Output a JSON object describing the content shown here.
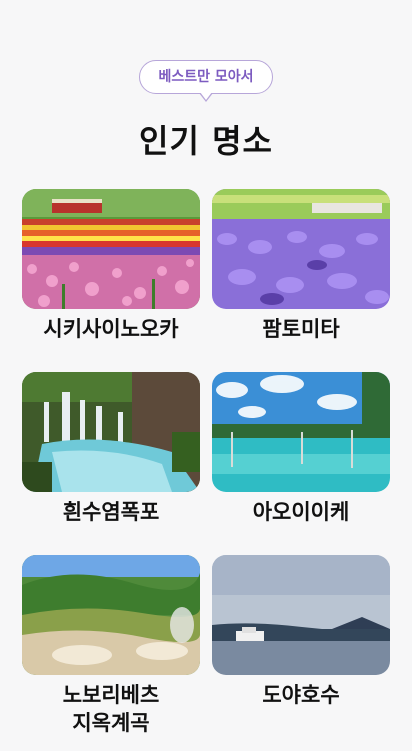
{
  "header": {
    "badge": "베스트만 모아서",
    "title": "인기 명소"
  },
  "places": [
    {
      "name": "시키사이노오카",
      "name2": ""
    },
    {
      "name": "팜토미타",
      "name2": ""
    },
    {
      "name": "흰수염폭포",
      "name2": ""
    },
    {
      "name": "아오이이케",
      "name2": ""
    },
    {
      "name": "노보리베츠",
      "name2": "지옥계곡"
    },
    {
      "name": "도야호수",
      "name2": ""
    }
  ]
}
